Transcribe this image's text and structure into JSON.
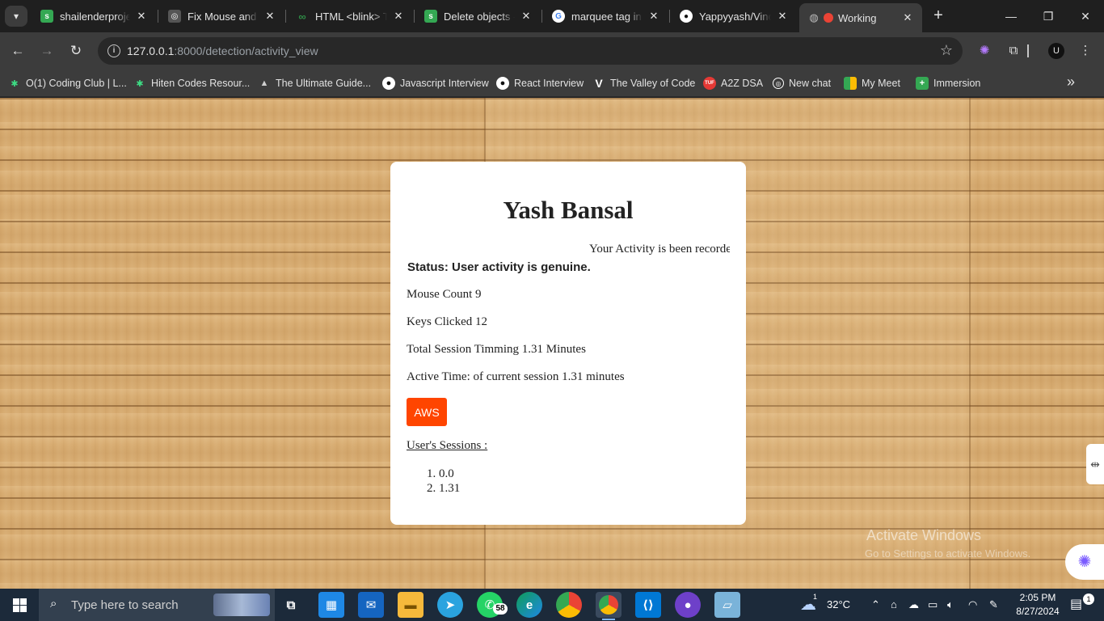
{
  "browser": {
    "tabs": [
      {
        "title": "shailenderproject",
        "favicon_color": "#34a853",
        "favicon_glyph": "s"
      },
      {
        "title": "Fix Mouse and Keyboard",
        "favicon_color": "#555555",
        "favicon_glyph": "◎"
      },
      {
        "title": "HTML <blink> Tag",
        "favicon_color": "#2f8d46",
        "favicon_glyph": "∞"
      },
      {
        "title": "Delete objects - ",
        "favicon_color": "#34a853",
        "favicon_glyph": "s"
      },
      {
        "title": "marquee tag in html",
        "favicon_color": "#ffffff",
        "favicon_glyph": "G"
      },
      {
        "title": "Yappyyash/Vinod",
        "favicon_color": "#ffffff",
        "favicon_glyph": "●"
      },
      {
        "title": "Working",
        "favicon_color": "#ea4335",
        "favicon_glyph": "●"
      }
    ],
    "url_host": "127.0.0.1",
    "url_path": ":8000/detection/activity_view",
    "bookmarks": [
      {
        "label": "O(1) Coding Club | L...",
        "icon": "asterisk-icon",
        "color": "#3ddc84"
      },
      {
        "label": "Hiten Codes Resour...",
        "icon": "asterisk-icon",
        "color": "#3ddc84"
      },
      {
        "label": "The Ultimate Guide...",
        "icon": "mountain-icon",
        "color": "#cfcfcf"
      },
      {
        "label": "Javascript Interview",
        "icon": "github-icon",
        "color": "#ffffff"
      },
      {
        "label": "React Interview",
        "icon": "github-icon",
        "color": "#ffffff"
      },
      {
        "label": "The Valley of Code",
        "icon": "v-icon",
        "color": "#ffffff"
      },
      {
        "label": "A2Z DSA",
        "icon": "tuf-icon",
        "color": "#e53935"
      },
      {
        "label": "New chat",
        "icon": "chatgpt-icon",
        "color": "#ffffff"
      },
      {
        "label": "My Meet",
        "icon": "meet-icon",
        "color": "#fbbc04"
      },
      {
        "label": "Immersion",
        "icon": "plus-icon",
        "color": "#34a853"
      }
    ]
  },
  "page": {
    "name": "Yash Bansal",
    "marquee": "Your Activity is been recorded",
    "status": "Status: User activity is genuine.",
    "stats": [
      "Mouse Count 9",
      "Keys Clicked 12",
      "Total Session Timming 1.31 Minutes",
      "Active Time: of current session 1.31 minutes"
    ],
    "aws_button": "AWS",
    "sessions_title": "User's Sessions :",
    "sessions": [
      "0.0",
      "1.31"
    ],
    "watermark_title": "Activate Windows",
    "watermark_sub": "Go to Settings to activate Windows."
  },
  "taskbar": {
    "search_placeholder": "Type here to search",
    "whatsapp_badge": "58",
    "weather_temp": "32°C",
    "weather_alert": "1",
    "time": "2:05 PM",
    "date": "8/27/2024",
    "notifications": "1"
  },
  "colors": {
    "aws_button": "#ff4500",
    "card": "#ffffff",
    "wood": "#d7ab70"
  }
}
